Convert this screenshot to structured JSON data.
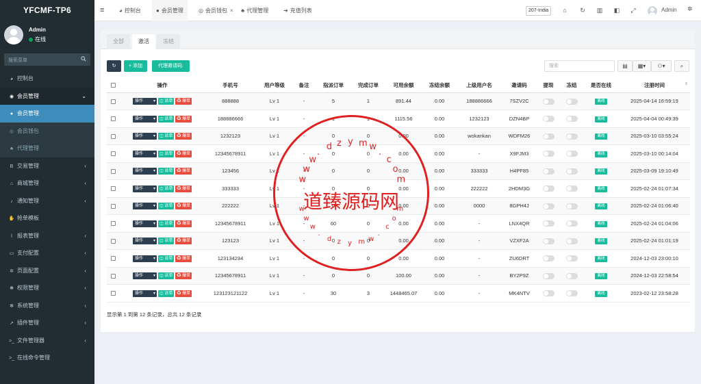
{
  "app": {
    "logo": "YFCMF-TP6"
  },
  "user": {
    "name": "Admin",
    "status": "在线"
  },
  "sidebar": {
    "search_placeholder": "搜索菜单",
    "items": [
      {
        "label": "控制台",
        "icon": "dashboard-icon"
      },
      {
        "label": "会员管理",
        "icon": "user-circle-icon"
      },
      {
        "label": "会员管理",
        "icon": "user-icon"
      },
      {
        "label": "会员钱包",
        "icon": "wallet-icon"
      },
      {
        "label": "代理管理",
        "icon": "sitemap-icon"
      },
      {
        "label": "交易管理",
        "icon": "bitcoin-icon"
      },
      {
        "label": "商城管理",
        "icon": "home-icon"
      },
      {
        "label": "通知管理",
        "icon": "bell-icon"
      },
      {
        "label": "抢单模板",
        "icon": "hand-icon"
      },
      {
        "label": "报表管理",
        "icon": "chart-icon"
      },
      {
        "label": "支付配置",
        "icon": "card-icon"
      },
      {
        "label": "页面配置",
        "icon": "cog-icon"
      },
      {
        "label": "权限管理",
        "icon": "group-icon"
      },
      {
        "label": "系统管理",
        "icon": "cogs-icon"
      },
      {
        "label": "插件管理",
        "icon": "rocket-icon"
      },
      {
        "label": "文件管理器",
        "icon": "terminal-icon"
      },
      {
        "label": "在线命令管理",
        "icon": "terminal-icon"
      }
    ]
  },
  "topbar": {
    "tabs": [
      "控制台",
      "会员管理",
      "会员钱包",
      "代理管理",
      "充值列表"
    ],
    "select_value": "207-India",
    "admin_label": "Admin"
  },
  "panel": {
    "tabs": [
      "全部",
      "激活",
      "冻结"
    ],
    "add_label": "+ 添加",
    "invite_label": "代理邀请码:",
    "search_placeholder": "搜索",
    "row_buttons": {
      "op": "操作",
      "paidan": "派单",
      "baodan": "爆单"
    },
    "online_badge": "离线",
    "summary": "显示第 1 到第 12 条记录，总共 12 条记录"
  },
  "table": {
    "headers": [
      "",
      "操作",
      "手机号",
      "用户等级",
      "备注",
      "指派订单",
      "完成订单",
      "可用余额",
      "冻结余额",
      "上级用户名",
      "邀请码",
      "提现",
      "冻结",
      "是否在线",
      "注册时间"
    ],
    "rows": [
      [
        "888888",
        "Lv 1",
        "-",
        "5",
        "1",
        "891.44",
        "0.00",
        "188886666",
        "7SZV2C",
        "2025-04-14 16:59:19"
      ],
      [
        "188886666",
        "Lv 1",
        "-",
        "1",
        "1",
        "1115.56",
        "0.00",
        "1232123",
        "DZN4BP",
        "2025-04-04 00:49:39"
      ],
      [
        "1232123",
        "Lv 1",
        "-",
        "0",
        "0",
        "0.00",
        "0.00",
        "wokankan",
        "WDFM26",
        "2025-03-10 03:55:24"
      ],
      [
        "12345678911",
        "Lv 1",
        "-",
        "0",
        "0",
        "0.00",
        "0.00",
        "-",
        "X9FJM3",
        "2025-03-10 00:14:04"
      ],
      [
        "123456",
        "Lv 1",
        "-",
        "0",
        "0",
        "0.00",
        "0.00",
        "333333",
        "H4PF85",
        "2025-03-09 19:10:49"
      ],
      [
        "333333",
        "Lv 1",
        "-",
        "0",
        "0",
        "0.00",
        "0.00",
        "222222",
        "2HDM3G",
        "2025-02-24 01:07:34"
      ],
      [
        "222222",
        "Lv 1",
        "-",
        "0",
        "0",
        "0.00",
        "0.00",
        "0000",
        "8GPH4J",
        "2025-02-24 01:06:40"
      ],
      [
        "12345678911",
        "Lv 1",
        "-",
        "60",
        "0",
        "0.00",
        "0.00",
        "-",
        "LNX4QR",
        "2025-02-24 01:04:06"
      ],
      [
        "123123",
        "Lv 1",
        "-",
        "0",
        "0",
        "0.00",
        "0.00",
        "-",
        "VZXF2A",
        "2025-02-24 01:01:19"
      ],
      [
        "123134234",
        "Lv 1",
        "-",
        "0",
        "0",
        "0.00",
        "0.00",
        "-",
        "ZU6DRT",
        "2024-12-03 23:00:10"
      ],
      [
        "12345678911",
        "Lv 1",
        "-",
        "0",
        "0",
        "100.00",
        "0.00",
        "-",
        "BY2P9Z",
        "2024-12-03 22:58:54"
      ],
      [
        "123123121122",
        "Lv 1",
        "-",
        "30",
        "3",
        "1448465.07",
        "0.00",
        "-",
        "MK4NTV",
        "2023-02-12 23:58:28"
      ]
    ]
  },
  "watermark": {
    "center_text": "道臻源码网",
    "top_letters": [
      "w",
      "w",
      "w",
      ".",
      "d",
      "z",
      "y",
      "m",
      "w",
      ".",
      "c",
      "o",
      "m"
    ],
    "bottom_letters": [
      "w",
      "w",
      "w",
      ".",
      "d",
      "z",
      "y",
      "m",
      "w",
      ".",
      "c",
      "o",
      "m"
    ]
  },
  "colors": {
    "sidebar": "#222d32",
    "active": "#3c8dbc",
    "green": "#18bc9c",
    "red": "#e74c3c",
    "dark": "#2c3e50",
    "stamp": "#e02020"
  }
}
